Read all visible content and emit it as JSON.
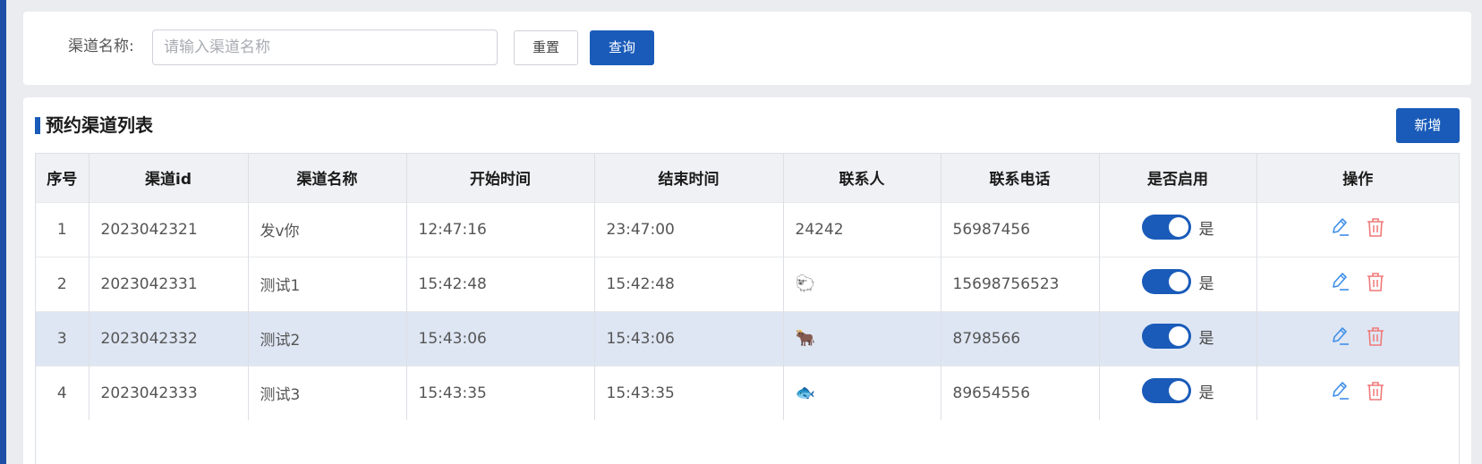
{
  "search": {
    "label": "渠道名称:",
    "placeholder": "请输入渠道名称",
    "value": "",
    "reset_label": "重置",
    "query_label": "查询"
  },
  "list": {
    "title": "预约渠道列表",
    "add_label": "新增",
    "columns": [
      "序号",
      "渠道id",
      "渠道名称",
      "开始时间",
      "结束时间",
      "联系人",
      "联系电话",
      "是否启用",
      "操作"
    ],
    "rows": [
      {
        "index": "1",
        "id": "2023042321",
        "name": "发v你",
        "start": "12:47:16",
        "end": "23:47:00",
        "contact": "24242",
        "contact_icon": "",
        "phone": "56987456",
        "enabled": true,
        "enabled_text": "是"
      },
      {
        "index": "2",
        "id": "2023042331",
        "name": "测试1",
        "start": "15:42:48",
        "end": "15:42:48",
        "contact": "",
        "contact_icon": "sheep-emoji",
        "phone": "15698756523",
        "enabled": true,
        "enabled_text": "是"
      },
      {
        "index": "3",
        "id": "2023042332",
        "name": "测试2",
        "start": "15:43:06",
        "end": "15:43:06",
        "contact": "",
        "contact_icon": "ox-emoji",
        "phone": "8798566",
        "enabled": true,
        "enabled_text": "是"
      },
      {
        "index": "4",
        "id": "2023042333",
        "name": "测试3",
        "start": "15:43:35",
        "end": "15:43:35",
        "contact": "",
        "contact_icon": "fish-emoji",
        "phone": "89654556",
        "enabled": true,
        "enabled_text": "是"
      }
    ]
  },
  "colors": {
    "primary": "#1a5bb9",
    "edit_icon": "#3d8ee8",
    "delete_icon": "#f07878",
    "highlight_row": "#dee6f3"
  }
}
